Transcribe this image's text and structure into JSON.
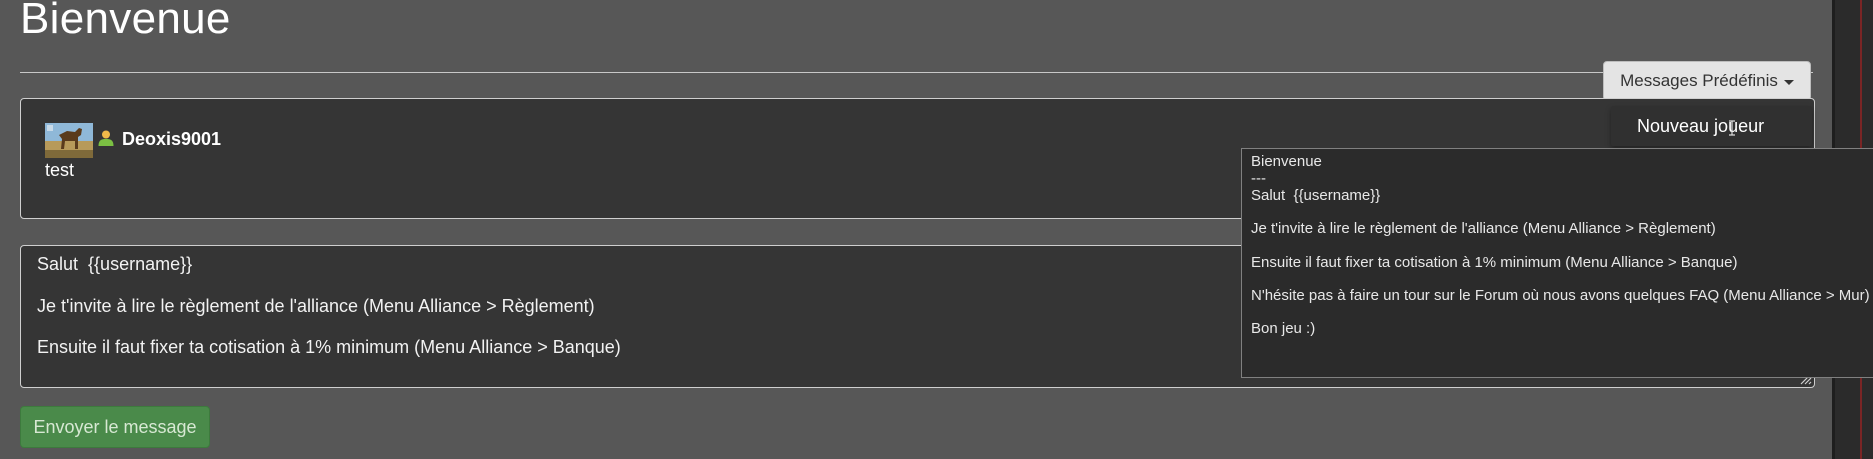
{
  "page": {
    "title": "Bienvenue"
  },
  "predefined": {
    "button_label": "Messages Prédéfinis",
    "menu_items": [
      "Nouveau joueur"
    ]
  },
  "message": {
    "username": "Deoxis9001",
    "text": "test"
  },
  "compose": {
    "lines": [
      "Salut  {{username}}",
      "Je t'invite à lire le règlement de l'alliance (Menu Alliance > Règlement)",
      "Ensuite il faut fixer ta cotisation à 1% minimum (Menu Alliance > Banque)"
    ]
  },
  "send_button": {
    "label": "Envoyer le message"
  },
  "tooltip": {
    "lines": [
      "Bienvenue",
      "---",
      "Salut  {{username}}",
      "Je t'invite à lire le règlement de l'alliance (Menu Alliance > Règlement)",
      "Ensuite il faut fixer ta cotisation à 1% minimum (Menu Alliance > Banque)",
      "N'hésite pas à faire un tour sur le Forum où nous avons quelques FAQ (Menu Alliance > Mur)",
      "Bon jeu :)"
    ]
  },
  "colors": {
    "background": "#575757",
    "panel": "#353535",
    "send_button": "#4a8a4a",
    "dropdown_button": "#e4e4e4"
  },
  "icons": {
    "user": "user-icon",
    "avatar": "player-avatar",
    "caret": "caret-down-icon",
    "cursor": "text-cursor-icon",
    "resize": "resize-grip-icon"
  }
}
